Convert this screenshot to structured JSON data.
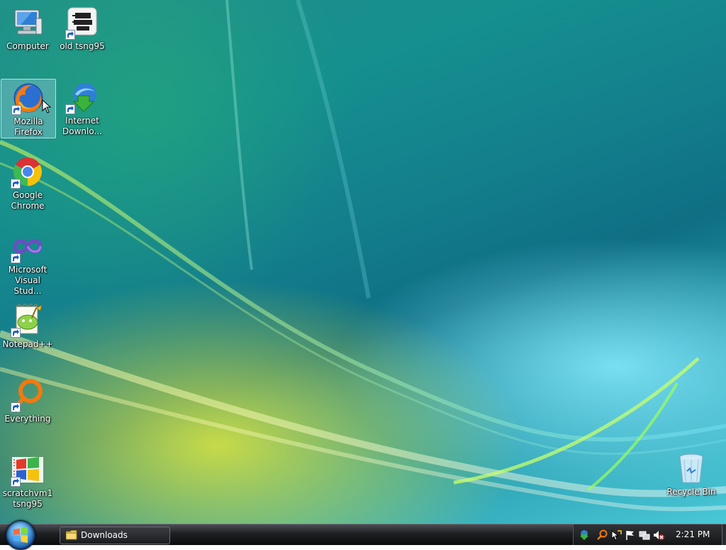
{
  "desktop": {
    "icons": [
      {
        "label": "Computer",
        "icon": "computer-icon"
      },
      {
        "label": "old tsng95",
        "icon": "network-share-icon"
      },
      {
        "label": "Mozilla Firefox",
        "icon": "firefox-icon"
      },
      {
        "label": "Internet Downlo...",
        "icon": "internet-download-manager-icon"
      },
      {
        "label": "Google Chrome",
        "icon": "chrome-icon"
      },
      {
        "label": "Microsoft Visual Stud...",
        "icon": "visual-studio-icon"
      },
      {
        "label": "Notepad++",
        "icon": "notepadpp-icon"
      },
      {
        "label": "Everything",
        "icon": "everything-search-icon"
      },
      {
        "label": "scratchvm1 tsng95",
        "icon": "remote-windows-icon"
      },
      {
        "label": "Recycle Bin",
        "icon": "recycle-bin-icon"
      }
    ]
  },
  "taskbar": {
    "tasks": [
      {
        "label": "Downloads",
        "icon": "folder-icon"
      }
    ],
    "tray_icons": [
      "internet-download-manager-tray-icon",
      "everything-tray-icon",
      "cursor-tray-icon",
      "action-center-flag-icon",
      "network-icon",
      "volume-muted-icon"
    ],
    "clock": "2:21 PM"
  },
  "colors": {
    "taskbar": "#1d1f22",
    "accent": "#1d5fae"
  }
}
